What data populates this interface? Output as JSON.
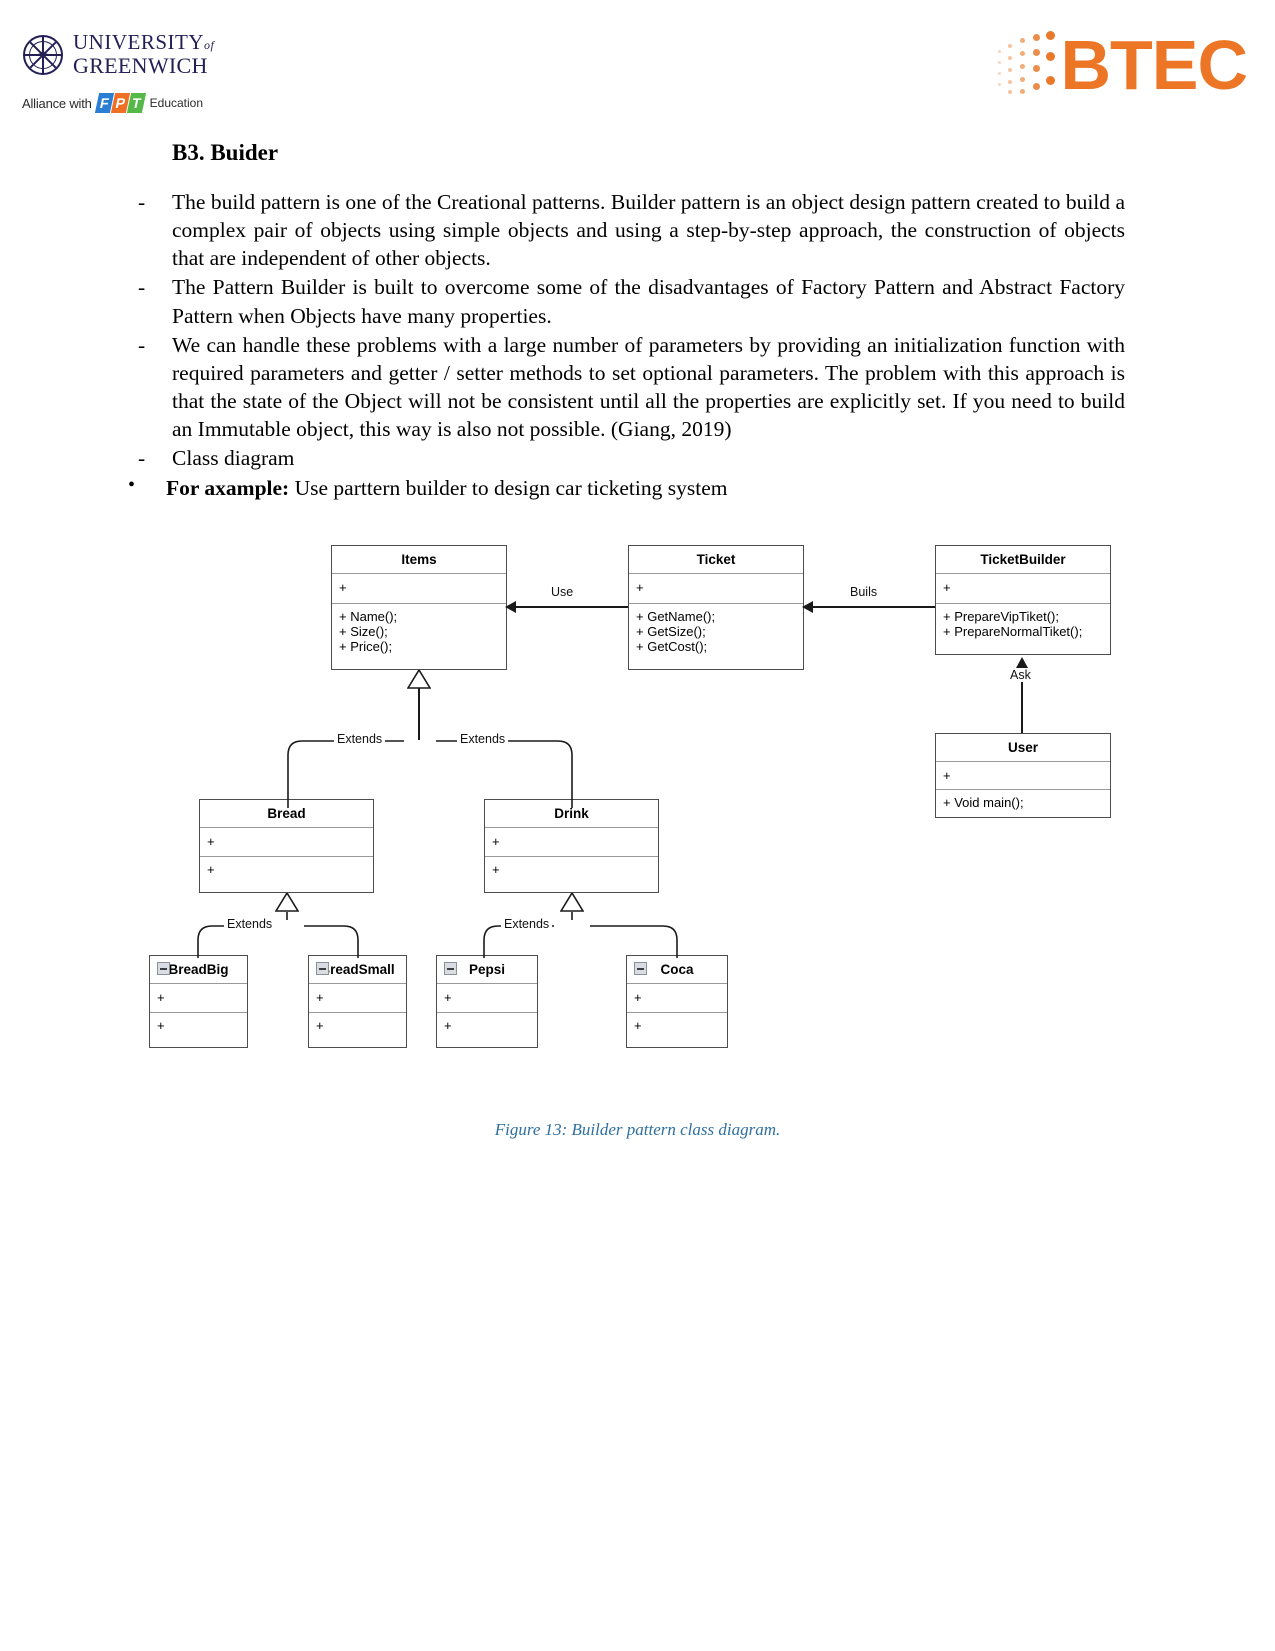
{
  "header": {
    "university": {
      "line1": "UNIVERSITY",
      "of": "of",
      "line2": "GREENWICH",
      "logo_icon": "compass-rose-icon"
    },
    "alliance": {
      "prefix": "Alliance with",
      "fpt_letters": [
        "F",
        "P",
        "T"
      ],
      "suffix": "Education"
    },
    "btec": {
      "word": "BTEC",
      "color": "#ec7625",
      "dots_icon": "pixel-dots-icon"
    }
  },
  "document": {
    "heading": "B3. Buider",
    "paragraphs": [
      {
        "marker": "-",
        "type": "dash",
        "text": "The build pattern is one of the Creational patterns. Builder pattern is an object design pattern created to build a complex pair of objects using simple objects and using a step-by-step approach, the construction of objects that are independent of other objects."
      },
      {
        "marker": "-",
        "type": "dash",
        "text": "The Pattern Builder is built to overcome some of the disadvantages of Factory Pattern and Abstract Factory Pattern when Objects have many properties."
      },
      {
        "marker": "-",
        "type": "dash",
        "text": "We can handle these problems with a large number of parameters by providing an initialization function with required parameters and getter / setter methods to set optional parameters. The problem with this approach is that the state of the Object will not be consistent until all the properties are explicitly set. If you need to build an Immutable object, this way is also not possible. (Giang, 2019)"
      },
      {
        "marker": "-",
        "type": "dash",
        "text": "Class diagram"
      },
      {
        "marker": "•",
        "type": "bullet",
        "bold_lead": "For axample:",
        "text": " Use parttern builder to design car ticketing system"
      }
    ],
    "caption": "Figure 13: Builder pattern class diagram."
  },
  "diagram": {
    "classes": {
      "items": {
        "name": "Items",
        "attributes": [
          "+"
        ],
        "operations": [
          "+ Name();",
          "+ Size();",
          "+ Price();"
        ],
        "has_badge": false
      },
      "ticket": {
        "name": "Ticket",
        "attributes": [
          "+"
        ],
        "operations": [
          "+ GetName();",
          "+ GetSize();",
          "+ GetCost();"
        ],
        "has_badge": false
      },
      "ticketbuilder": {
        "name": "TicketBuilder",
        "attributes": [
          "+"
        ],
        "operations": [
          "+ PrepareVipTiket();",
          "+ PrepareNormalTiket();"
        ],
        "has_badge": false
      },
      "user": {
        "name": "User",
        "attributes": [
          "+"
        ],
        "operations": [
          "+ Void main();"
        ],
        "has_badge": false
      },
      "bread": {
        "name": "Bread",
        "attributes": [
          "+"
        ],
        "operations": [
          "+"
        ],
        "has_badge": false
      },
      "drink": {
        "name": "Drink",
        "attributes": [
          "+"
        ],
        "operations": [
          "+"
        ],
        "has_badge": false
      },
      "breadbig": {
        "name": "BreadBig",
        "attributes": [
          "+"
        ],
        "operations": [
          "+"
        ],
        "has_badge": true
      },
      "breadsmall": {
        "name": "BreadSmall",
        "attributes": [
          "+"
        ],
        "operations": [
          "+"
        ],
        "has_badge": true
      },
      "pepsi": {
        "name": "Pepsi",
        "attributes": [
          "+"
        ],
        "operations": [
          "+"
        ],
        "has_badge": true
      },
      "coca": {
        "name": "Coca",
        "attributes": [
          "+"
        ],
        "operations": [
          "+"
        ],
        "has_badge": true
      }
    },
    "relations": {
      "use": "Use",
      "builds": "Buils",
      "ask": "Ask",
      "extends_left": "Extends",
      "extends_right": "Extends",
      "extends_bread": "Extends",
      "extends_drink": "Extends"
    }
  }
}
